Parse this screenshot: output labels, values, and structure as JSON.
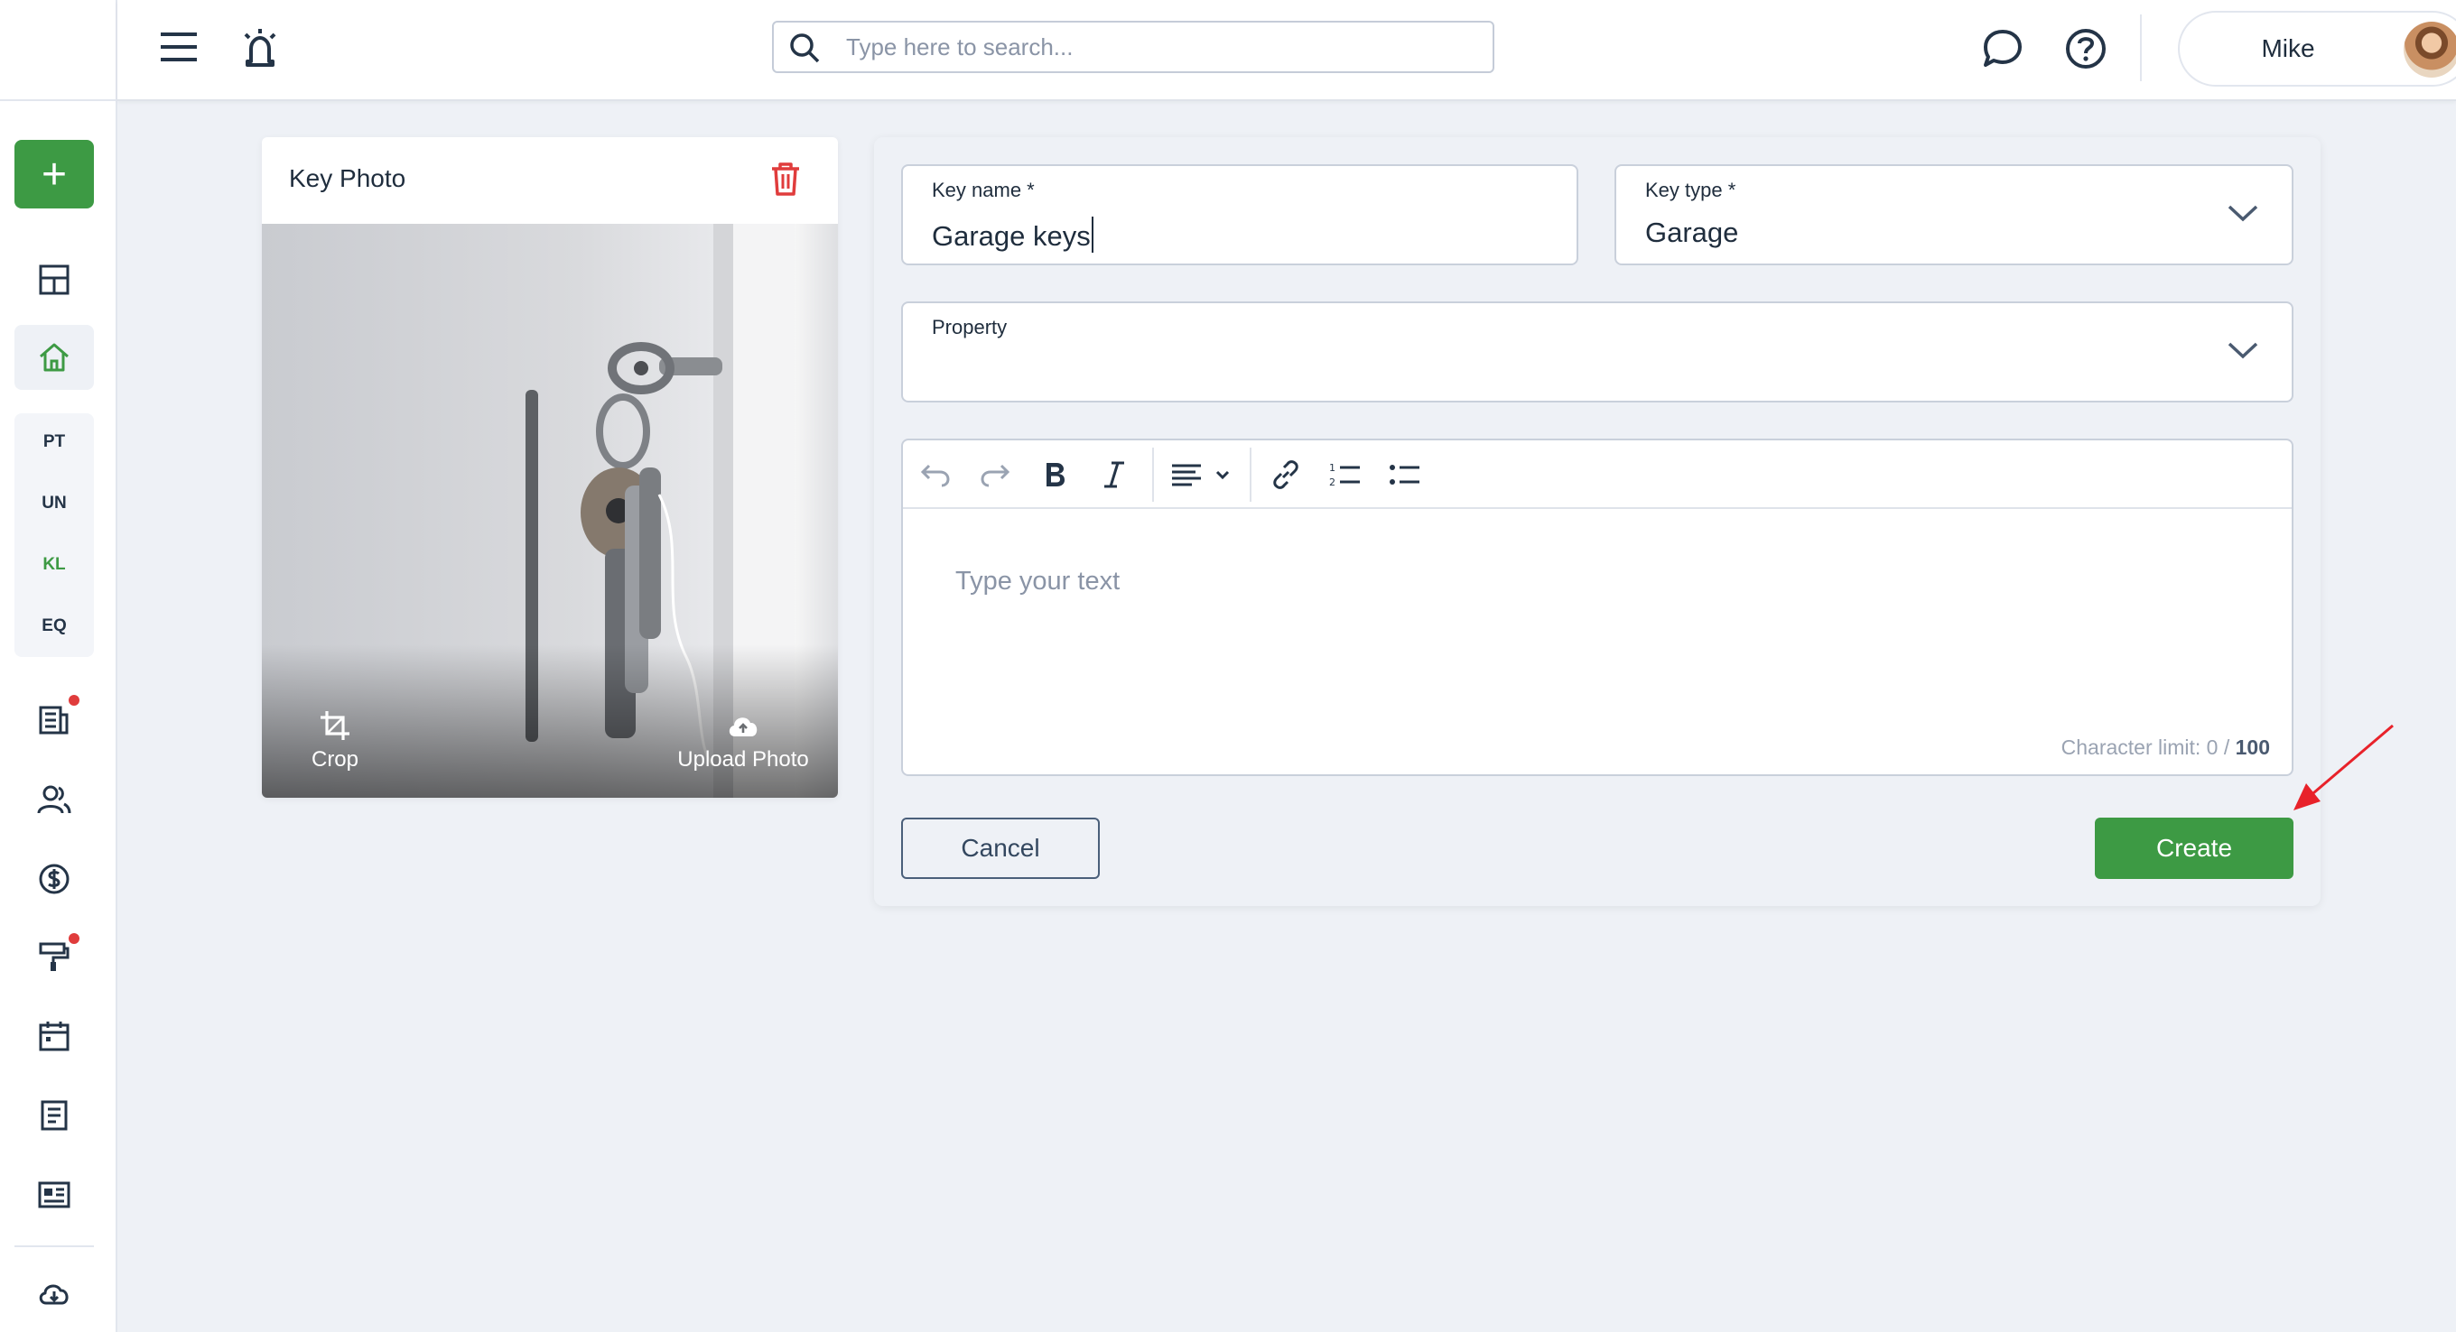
{
  "topbar": {
    "search_placeholder": "Type here to search...",
    "user_name": "Mike"
  },
  "sidebar": {
    "add_label": "+",
    "sections": [
      "PT",
      "UN",
      "KL",
      "EQ"
    ],
    "active_section": "KL"
  },
  "photo_card": {
    "title": "Key Photo",
    "crop_label": "Crop",
    "upload_label": "Upload Photo"
  },
  "form": {
    "key_name": {
      "label": "Key name *",
      "value": "Garage keys"
    },
    "key_type": {
      "label": "Key type *",
      "value": "Garage"
    },
    "property": {
      "label": "Property",
      "value": ""
    },
    "editor": {
      "placeholder": "Type your text",
      "char_limit_label": "Character limit: 0 / ",
      "char_limit_max": "100"
    },
    "cancel_label": "Cancel",
    "create_label": "Create"
  },
  "colors": {
    "accent": "#3d9a44",
    "background": "#eef1f6",
    "danger": "#e03c3c",
    "annotation_arrow": "#e8222a"
  }
}
